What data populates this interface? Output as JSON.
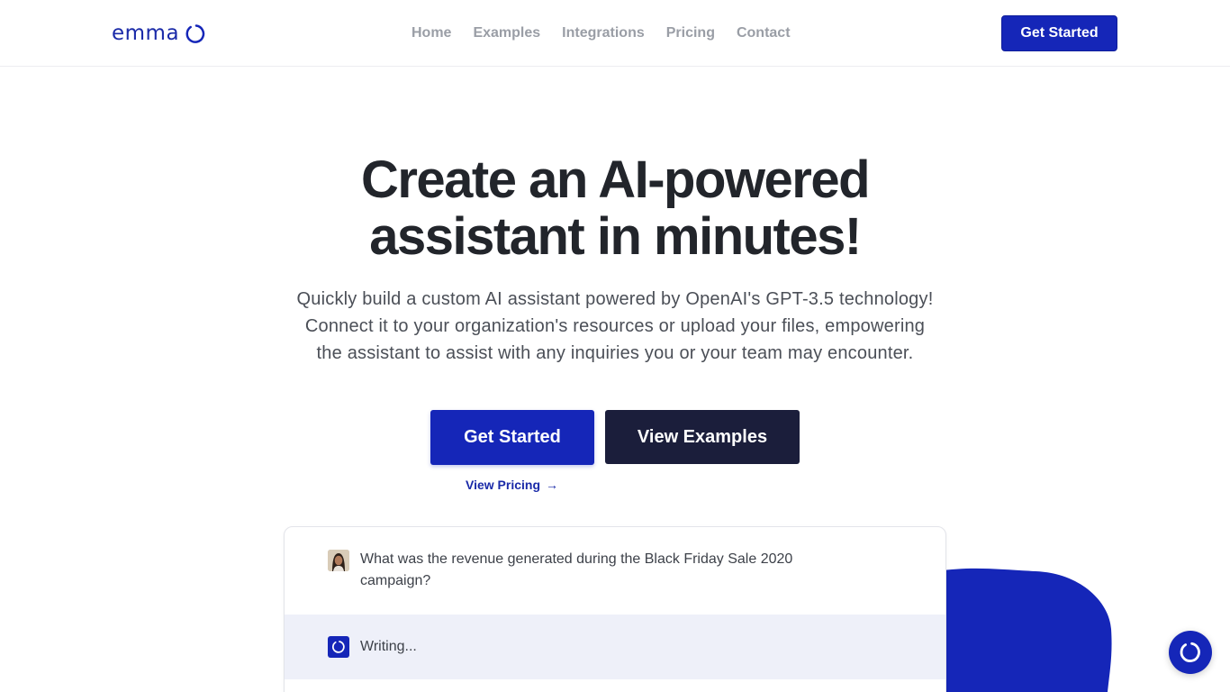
{
  "brand": {
    "name": "emma",
    "accent": "#1526b8",
    "dark": "#1b1e3b"
  },
  "nav": {
    "items": [
      {
        "label": "Home"
      },
      {
        "label": "Examples"
      },
      {
        "label": "Integrations"
      },
      {
        "label": "Pricing"
      },
      {
        "label": "Contact"
      }
    ],
    "cta_label": "Get Started"
  },
  "hero": {
    "title_line1": "Create an AI-powered",
    "title_line2": "assistant in minutes!",
    "subtitle_line1": "Quickly build a custom AI assistant powered by OpenAI's GPT-3.5 technology!",
    "subtitle_line2": "Connect it to your organization's resources or upload your files, empowering",
    "subtitle_line3": "the assistant to assist with any inquiries you or your team may encounter.",
    "primary_button": "Get Started",
    "secondary_button": "View Examples",
    "pricing_link": "View Pricing",
    "pricing_arrow": "→"
  },
  "chat": {
    "user_message": "What was the revenue generated during the Black Friday Sale 2020 campaign?",
    "bot_status": "Writing..."
  },
  "icons": {
    "logo": "ring-logo-icon",
    "avatar": "user-avatar",
    "bot": "assistant-ring-icon",
    "launcher": "chat-launcher-icon"
  }
}
